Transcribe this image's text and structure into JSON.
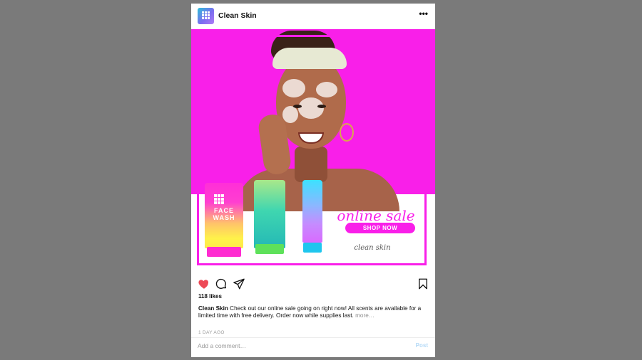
{
  "post": {
    "username": "Clean Skin",
    "more_icon": "•••",
    "likes": "118 likes",
    "caption_user": "Clean Skin",
    "caption_text": " Check out our online sale going on right now! All scents are available for a limited time with free delivery. Order now while supplies last. ",
    "caption_more": "more…",
    "timestamp": "1 DAY AGO",
    "comment_placeholder": "Add a comment…",
    "post_label": "Post"
  },
  "ad": {
    "headline": "online sale",
    "button": "SHOP NOW",
    "brand": "clean skin",
    "product_label": "FACE WASH"
  },
  "colors": {
    "accent": "#f91fe9",
    "heart": "#ed4956",
    "background": "#7a7a7a"
  },
  "icons": [
    "heart-icon",
    "comment-icon",
    "share-icon",
    "bookmark-icon",
    "more-icon"
  ]
}
